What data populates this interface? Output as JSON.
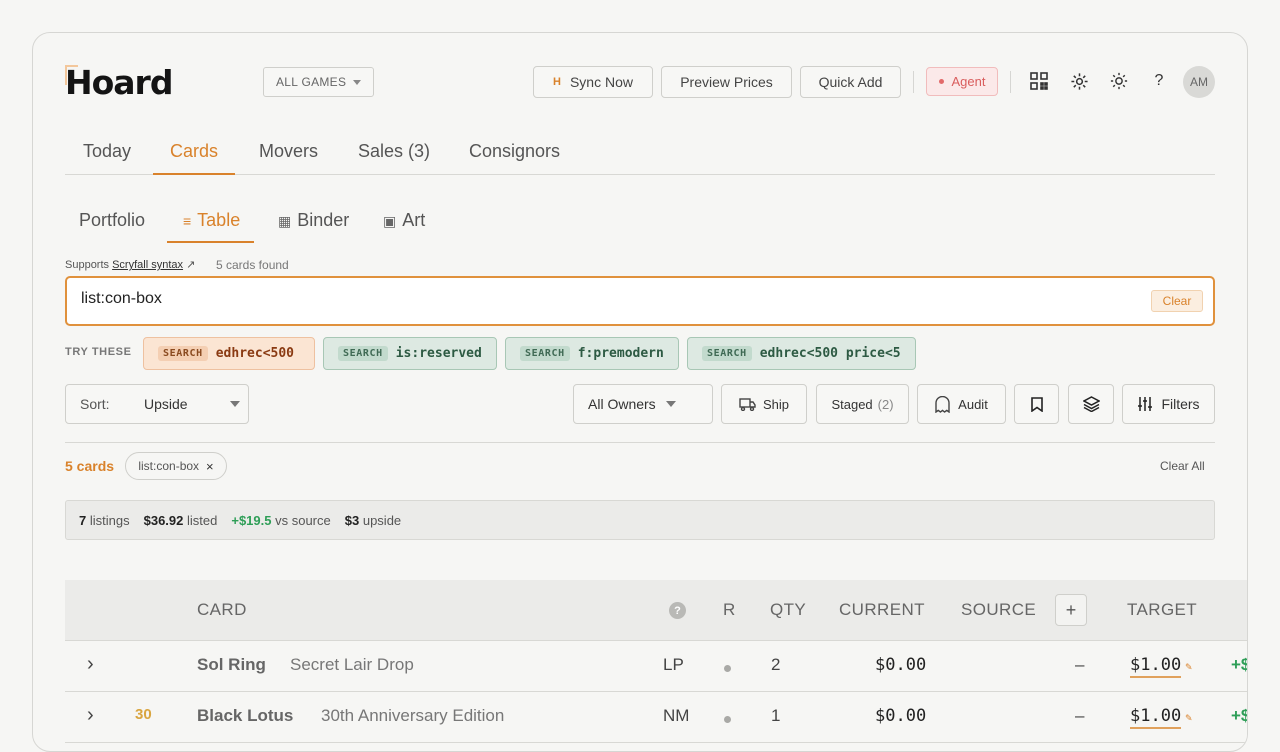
{
  "app": {
    "logo": "Hoard"
  },
  "header": {
    "games_select": "ALL GAMES",
    "sync_icon_letter": "H",
    "sync_label": "Sync Now",
    "preview_label": "Preview Prices",
    "quick_add_label": "Quick Add",
    "agent_label": "Agent",
    "help_glyph": "?",
    "avatar": "AM"
  },
  "tabs": [
    "Today",
    "Cards",
    "Movers",
    "Sales (3)",
    "Consignors"
  ],
  "subtabs": [
    {
      "glyph": "",
      "label": "Portfolio"
    },
    {
      "glyph": "≡",
      "label": "Table"
    },
    {
      "glyph": "▦",
      "label": "Binder"
    },
    {
      "glyph": "▣",
      "label": "Art"
    }
  ],
  "search": {
    "hint_prefix": "Supports",
    "hint_link": "Scryfall syntax",
    "hint_arrow": "↗",
    "found": "5 cards found",
    "value": "list:con-box",
    "clear_label": "Clear"
  },
  "suggestions": {
    "label": "TRY THESE",
    "tag": "SEARCH",
    "items": [
      "edhrec<500",
      "is:reserved",
      "f:premodern",
      "edhrec<500 price<5"
    ]
  },
  "toolbar": {
    "sort_label": "Sort:",
    "sort_value": "Upside",
    "owners": "All Owners",
    "ship": "Ship",
    "staged": "Staged",
    "staged_count": "(2)",
    "audit": "Audit",
    "filters": "Filters"
  },
  "results": {
    "count": "5 cards",
    "filter_pill": "list:con-box",
    "pill_close": "×",
    "clear_all": "Clear All"
  },
  "stats": {
    "listings_num": "7",
    "listings_label": "listings",
    "listed_num": "$36.92",
    "listed_label": "listed",
    "vs_num": "+$19.5",
    "vs_label": "vs source",
    "upside_num": "$3",
    "upside_label": "upside"
  },
  "table": {
    "columns": [
      "CARD",
      "?",
      "R",
      "QTY",
      "CURRENT",
      "SOURCE",
      "+",
      "TARGET"
    ],
    "rows": [
      {
        "expand": "›",
        "badge": "",
        "name": "Sol Ring",
        "set": "Secret Lair Drop",
        "condition": "LP",
        "qty": "2",
        "current": "$0.00",
        "source": "–",
        "target": "$1.00",
        "gain": "+$"
      },
      {
        "expand": "›",
        "badge": "30",
        "name": "Black Lotus",
        "set": "30th Anniversary Edition",
        "condition": "NM",
        "qty": "1",
        "current": "$0.00",
        "source": "–",
        "target": "$1.00",
        "gain": "+$"
      }
    ]
  }
}
